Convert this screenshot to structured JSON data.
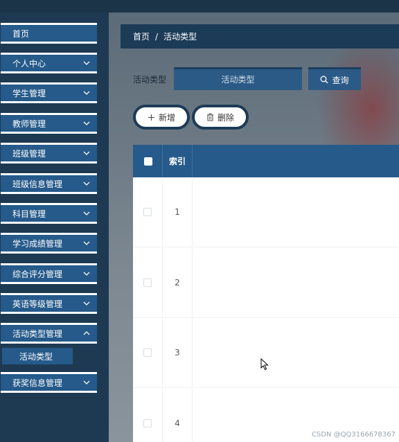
{
  "sidebar": {
    "items": [
      {
        "label": "首页",
        "has_chevron": false
      },
      {
        "label": "个人中心",
        "has_chevron": true
      },
      {
        "label": "学生管理",
        "has_chevron": true
      },
      {
        "label": "教师管理",
        "has_chevron": true
      },
      {
        "label": "班级管理",
        "has_chevron": true
      },
      {
        "label": "班级信息管理",
        "has_chevron": true
      },
      {
        "label": "科目管理",
        "has_chevron": true
      },
      {
        "label": "学习成绩管理",
        "has_chevron": true
      },
      {
        "label": "综合评分管理",
        "has_chevron": true
      },
      {
        "label": "英语等级管理",
        "has_chevron": true
      },
      {
        "label": "活动类型管理",
        "has_chevron": true,
        "expanded": true
      },
      {
        "label": "获奖信息管理",
        "has_chevron": true
      }
    ],
    "submenu_active": "活动类型"
  },
  "breadcrumb": {
    "home": "首页",
    "separator": "/",
    "current": "活动类型"
  },
  "search": {
    "label": "活动类型",
    "placeholder": "活动类型",
    "button_label": "查询"
  },
  "actions": {
    "add_label": "新增",
    "delete_label": "删除"
  },
  "table": {
    "header_index": "索引",
    "rows": [
      {
        "index": "1"
      },
      {
        "index": "2"
      },
      {
        "index": "3"
      },
      {
        "index": "4"
      }
    ]
  },
  "watermark": "CSDN @QQ3166678367",
  "colors": {
    "sidebar_bg": "#1e3a52",
    "menu_item_bg": "#255a8a",
    "table_header_bg": "#265a8a",
    "breadcrumb_bg": "#1c3b56"
  }
}
